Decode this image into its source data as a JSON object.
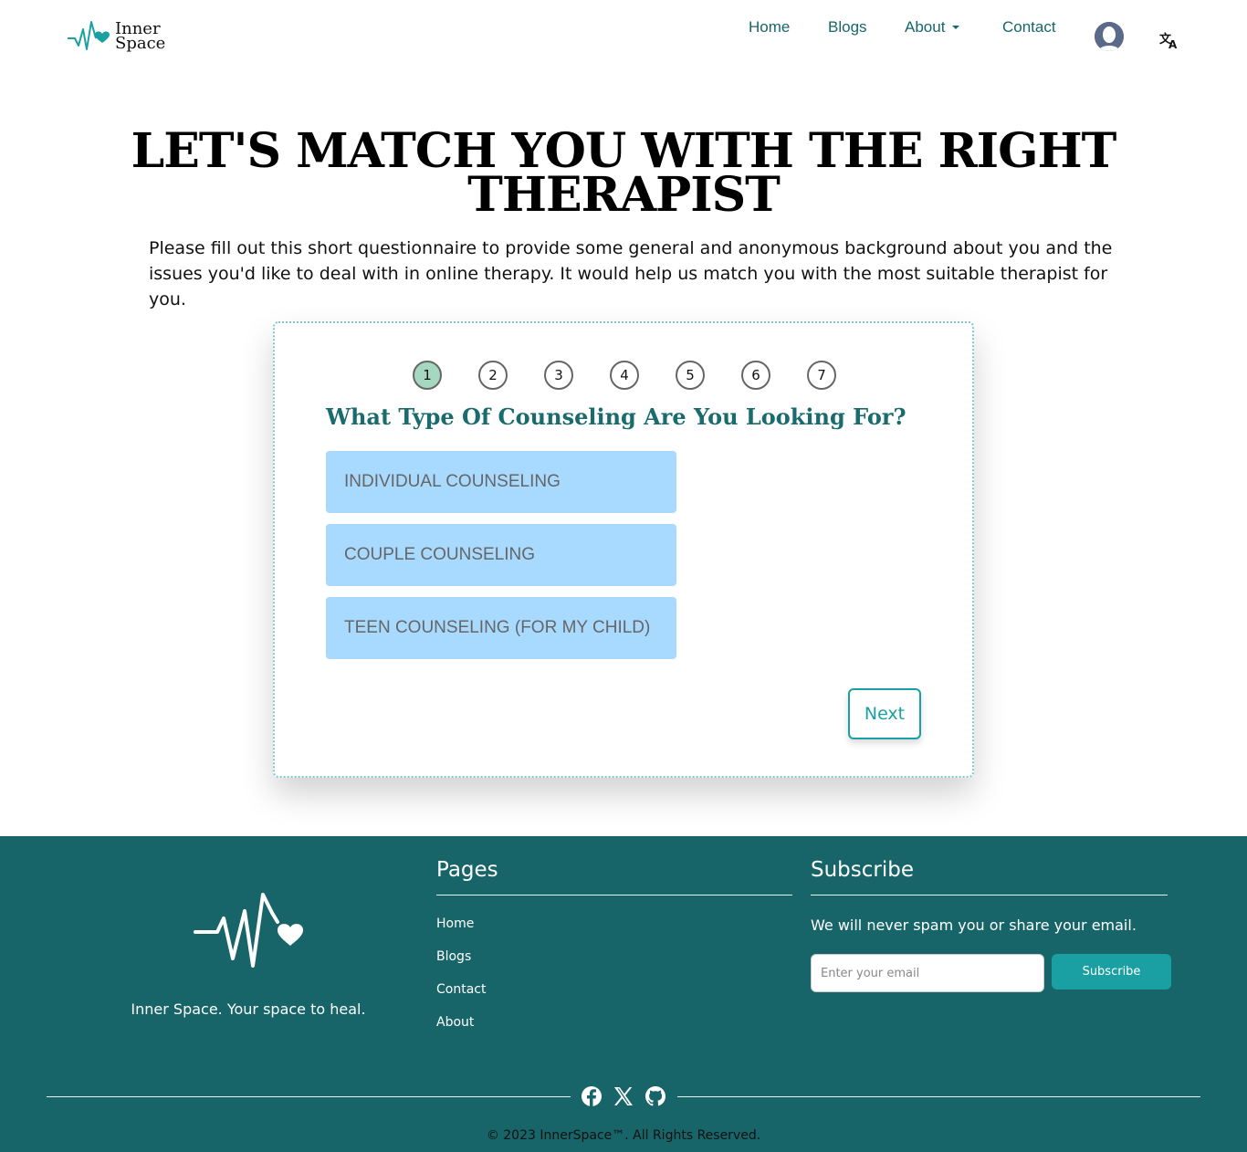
{
  "header": {
    "logo_line1": "Inner",
    "logo_line2": "Space",
    "nav": {
      "home": "Home",
      "blogs": "Blogs",
      "about": "About",
      "contact": "Contact"
    },
    "avatar_icon": "user-avatar-icon",
    "translate_icon": "translate-icon"
  },
  "hero": {
    "title_line1": "LET'S MATCH YOU WITH THE RIGHT",
    "title_line2": "THERAPIST",
    "description": "Please fill out this short questionnaire to provide some general and anonymous background about you and the issues you'd like to deal with in online therapy. It would help us match you with the most suitable therapist for you."
  },
  "questionnaire": {
    "steps": [
      "1",
      "2",
      "3",
      "4",
      "5",
      "6",
      "7"
    ],
    "active_step": 1,
    "question": "What Type Of Counseling Are You Looking For?",
    "options": [
      "INDIVIDUAL COUNSELING",
      "COUPLE COUNSELING",
      "TEEN COUNSELING (FOR MY CHILD)"
    ],
    "next_label": "Next"
  },
  "footer": {
    "tagline": "Inner Space. Your space to heal.",
    "pages_title": "Pages",
    "links": [
      "Home",
      "Blogs",
      "Contact",
      "About"
    ],
    "subscribe_title": "Subscribe",
    "subscribe_text": "We will never spam you or share your email.",
    "email_placeholder": "Enter your email",
    "subscribe_button": "Subscribe",
    "social_icons": [
      "facebook-icon",
      "x-icon",
      "github-icon"
    ],
    "copyright": "© 2023 InnerSpace™. All Rights Reserved."
  },
  "colors": {
    "primary": "#1a9fa3",
    "footer_bg": "#176569",
    "heading_teal": "#1a6b6e",
    "option_bg": "#a8daff",
    "active_step": "#a6d8c1"
  }
}
